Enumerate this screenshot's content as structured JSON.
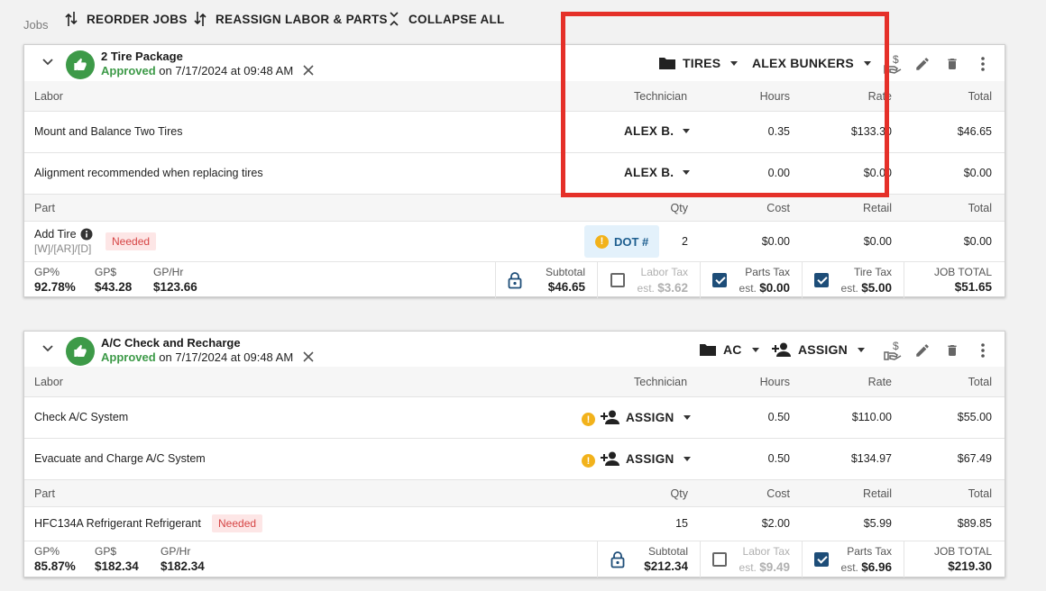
{
  "toolbar": {
    "label": "Jobs",
    "reorder": "REORDER JOBS",
    "reassign": "REASSIGN LABOR & PARTS",
    "collapse": "COLLAPSE ALL"
  },
  "jobs": [
    {
      "title": "2 Tire Package",
      "status": "Approved",
      "status_rest": " on 7/17/2024 at 09:48 AM",
      "category": "TIRES",
      "assignee": "ALEX BUNKERS",
      "labor_header": {
        "name": "Labor",
        "tech": "Technician",
        "hours": "Hours",
        "rate": "Rate",
        "total": "Total"
      },
      "labor": [
        {
          "name": "Mount and Balance Two Tires",
          "tech": "ALEX B.",
          "hours": "0.35",
          "rate": "$133.30",
          "total": "$46.65"
        },
        {
          "name": "Alignment recommended when replacing tires",
          "tech": "ALEX B.",
          "hours": "0.00",
          "rate": "$0.00",
          "total": "$0.00"
        }
      ],
      "parts_header": {
        "name": "Part",
        "qty": "Qty",
        "cost": "Cost",
        "retail": "Retail",
        "total": "Total"
      },
      "parts": [
        {
          "name": "Add Tire",
          "sub": "[W]/[AR]/[D]",
          "badge": "Needed",
          "dot": "DOT #",
          "qty": "2",
          "cost": "$0.00",
          "retail": "$0.00",
          "total": "$0.00"
        }
      ],
      "totals": {
        "gp_pct_label": "GP%",
        "gp_pct": "92.78%",
        "gp_label": "GP$",
        "gp": "$43.28",
        "gphr_label": "GP/Hr",
        "gphr": "$123.66",
        "subtotal_label": "Subtotal",
        "subtotal": "$46.65",
        "labor_tax_label": "Labor Tax",
        "labor_tax": "$3.62",
        "parts_tax_label": "Parts Tax",
        "parts_tax": "$0.00",
        "tire_tax_label": "Tire Tax",
        "tire_tax": "$5.00",
        "est": "est.",
        "job_total_label": "JOB TOTAL",
        "job_total": "$51.65"
      }
    },
    {
      "title": "A/C Check and Recharge",
      "status": "Approved",
      "status_rest": " on 7/17/2024 at 09:48 AM",
      "category": "AC",
      "assignee": "ASSIGN",
      "labor_header": {
        "name": "Labor",
        "tech": "Technician",
        "hours": "Hours",
        "rate": "Rate",
        "total": "Total"
      },
      "labor": [
        {
          "name": "Check A/C System",
          "tech": "ASSIGN",
          "hours": "0.50",
          "rate": "$110.00",
          "total": "$55.00"
        },
        {
          "name": "Evacuate and Charge A/C System",
          "tech": "ASSIGN",
          "hours": "0.50",
          "rate": "$134.97",
          "total": "$67.49"
        }
      ],
      "parts_header": {
        "name": "Part",
        "qty": "Qty",
        "cost": "Cost",
        "retail": "Retail",
        "total": "Total"
      },
      "parts": [
        {
          "name": "HFC134A Refrigerant Refrigerant",
          "badge": "Needed",
          "qty": "15",
          "cost": "$2.00",
          "retail": "$5.99",
          "total": "$89.85"
        }
      ],
      "totals": {
        "gp_pct_label": "GP%",
        "gp_pct": "85.87%",
        "gp_label": "GP$",
        "gp": "$182.34",
        "gphr_label": "GP/Hr",
        "gphr": "$182.34",
        "subtotal_label": "Subtotal",
        "subtotal": "$212.34",
        "labor_tax_label": "Labor Tax",
        "labor_tax": "$9.49",
        "parts_tax_label": "Parts Tax",
        "parts_tax": "$6.96",
        "est": "est.",
        "job_total_label": "JOB TOTAL",
        "job_total": "$219.30"
      }
    }
  ],
  "colors": {
    "approved": "#3d9a48",
    "needed_bg": "#fde6e6",
    "needed_text": "#d64545",
    "checkbox": "#1d4d78",
    "highlight": "#e53029"
  }
}
